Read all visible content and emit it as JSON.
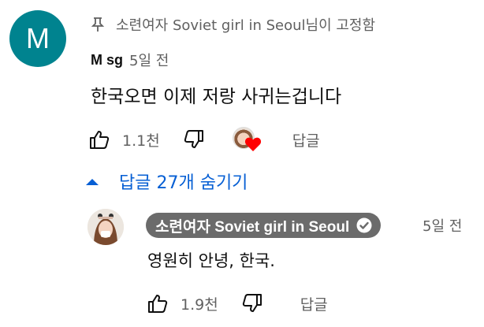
{
  "pinned_comment": {
    "avatar_letter": "M",
    "pinned_prefix": "소련여자 Soviet girl in Seoul",
    "pinned_suffix": "님이 고정함",
    "author": "M sg",
    "time": "5일 전",
    "text": "한국오면 이제 저랑 사귀는겁니다",
    "like_count": "1.1천",
    "reply_label": "답글"
  },
  "replies_toggle": {
    "label": "답글 27개 숨기기"
  },
  "reply": {
    "author": "소련여자 Soviet girl in Seoul",
    "time": "5일 전",
    "text": "영원히 안녕, 한국.",
    "like_count": "1.9천",
    "reply_label": "답글"
  },
  "colors": {
    "avatar_bg": "#00838f",
    "link_blue": "#065fd4",
    "heart_red": "#ff0000",
    "author_chip_bg": "#6b6b6b"
  }
}
